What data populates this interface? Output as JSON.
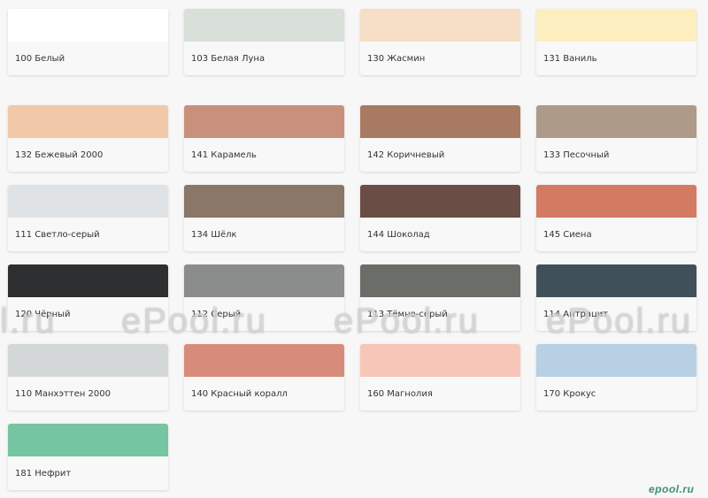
{
  "colors": [
    {
      "label": "100 Белый",
      "hex": "#ffffff"
    },
    {
      "label": "103 Белая Луна",
      "hex": "#d8e0d9"
    },
    {
      "label": "130 Жасмин",
      "hex": "#f6dfc6"
    },
    {
      "label": "131 Ваниль",
      "hex": "#fdeec0"
    },
    {
      "label": "132 Бежевый 2000",
      "hex": "#f1c9a8"
    },
    {
      "label": "141 Карамель",
      "hex": "#c9917b"
    },
    {
      "label": "142 Коричневый",
      "hex": "#a97a62"
    },
    {
      "label": "133 Песочный",
      "hex": "#ae9a88"
    },
    {
      "label": "111 Светло-серый",
      "hex": "#dfe3e5"
    },
    {
      "label": "134 Шёлк",
      "hex": "#8a7767"
    },
    {
      "label": "144 Шоколад",
      "hex": "#6a4d45"
    },
    {
      "label": "145 Сиена",
      "hex": "#d37a62"
    },
    {
      "label": "120 Чёрный",
      "hex": "#2e2f30"
    },
    {
      "label": "112 Серый",
      "hex": "#8a8d8b"
    },
    {
      "label": "113 Тёмно-серый",
      "hex": "#6b6d68"
    },
    {
      "label": "114 Антрацит",
      "hex": "#3f5058"
    },
    {
      "label": "110 Манхэттен 2000",
      "hex": "#d3d7d8"
    },
    {
      "label": "140 Красный коралл",
      "hex": "#d78c7b"
    },
    {
      "label": "160 Магнолия",
      "hex": "#f8c6b8"
    },
    {
      "label": "170 Крокус",
      "hex": "#b7d0e3"
    },
    {
      "label": "181 Нефрит",
      "hex": "#75c4a2"
    }
  ],
  "watermarks": [
    "l.ru",
    "ePool.ru",
    "ePool.ru",
    "ePool.ru"
  ],
  "logo": "epool.ru"
}
